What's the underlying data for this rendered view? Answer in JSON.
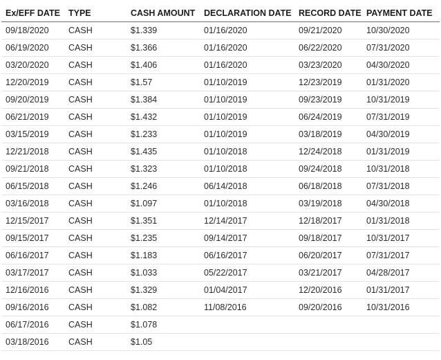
{
  "headers": [
    "Ex/EFF DATE",
    "TYPE",
    "CASH AMOUNT",
    "DECLARATION DATE",
    "RECORD DATE",
    "PAYMENT DATE"
  ],
  "rows": [
    [
      "09/18/2020",
      "CASH",
      "$1.339",
      "01/16/2020",
      "09/21/2020",
      "10/30/2020"
    ],
    [
      "06/19/2020",
      "CASH",
      "$1.366",
      "01/16/2020",
      "06/22/2020",
      "07/31/2020"
    ],
    [
      "03/20/2020",
      "CASH",
      "$1.406",
      "01/16/2020",
      "03/23/2020",
      "04/30/2020"
    ],
    [
      "12/20/2019",
      "CASH",
      "$1.57",
      "01/10/2019",
      "12/23/2019",
      "01/31/2020"
    ],
    [
      "09/20/2019",
      "CASH",
      "$1.384",
      "01/10/2019",
      "09/23/2019",
      "10/31/2019"
    ],
    [
      "06/21/2019",
      "CASH",
      "$1.432",
      "01/10/2019",
      "06/24/2019",
      "07/31/2019"
    ],
    [
      "03/15/2019",
      "CASH",
      "$1.233",
      "01/10/2019",
      "03/18/2019",
      "04/30/2019"
    ],
    [
      "12/21/2018",
      "CASH",
      "$1.435",
      "01/10/2018",
      "12/24/2018",
      "01/31/2019"
    ],
    [
      "09/21/2018",
      "CASH",
      "$1.323",
      "01/10/2018",
      "09/24/2018",
      "10/31/2018"
    ],
    [
      "06/15/2018",
      "CASH",
      "$1.246",
      "06/14/2018",
      "06/18/2018",
      "07/31/2018"
    ],
    [
      "03/16/2018",
      "CASH",
      "$1.097",
      "01/10/2018",
      "03/19/2018",
      "04/30/2018"
    ],
    [
      "12/15/2017",
      "CASH",
      "$1.351",
      "12/14/2017",
      "12/18/2017",
      "01/31/2018"
    ],
    [
      "09/15/2017",
      "CASH",
      "$1.235",
      "09/14/2017",
      "09/18/2017",
      "10/31/2017"
    ],
    [
      "06/16/2017",
      "CASH",
      "$1.183",
      "06/16/2017",
      "06/20/2017",
      "07/31/2017"
    ],
    [
      "03/17/2017",
      "CASH",
      "$1.033",
      "05/22/2017",
      "03/21/2017",
      "04/28/2017"
    ],
    [
      "12/16/2016",
      "CASH",
      "$1.329",
      "01/04/2017",
      "12/20/2016",
      "01/31/2017"
    ],
    [
      "09/16/2016",
      "CASH",
      "$1.082",
      "11/08/2016",
      "09/20/2016",
      "10/31/2016"
    ],
    [
      "06/17/2016",
      "CASH",
      "$1.078",
      "",
      "",
      ""
    ],
    [
      "03/18/2016",
      "CASH",
      "$1.05",
      "",
      "",
      ""
    ]
  ]
}
